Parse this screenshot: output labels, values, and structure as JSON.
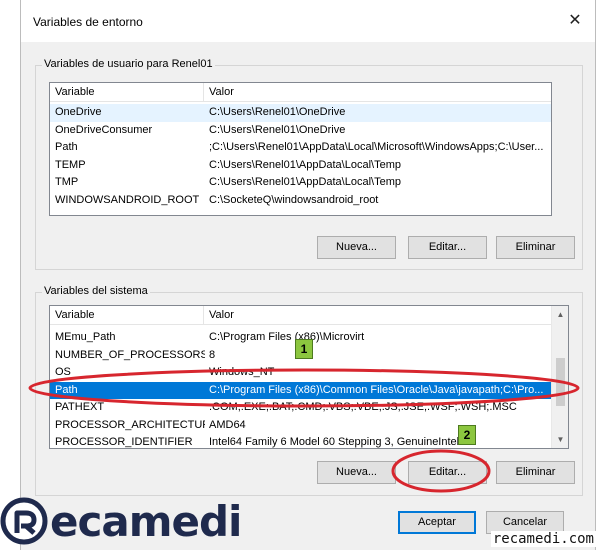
{
  "window": {
    "title": "Variables de entorno",
    "close_glyph": "✕"
  },
  "user_vars": {
    "group_label": "Variables de usuario para Renel01",
    "headers": [
      "Variable",
      "Valor"
    ],
    "rows": [
      {
        "name": "OneDrive",
        "value": "C:\\Users\\Renel01\\OneDrive"
      },
      {
        "name": "OneDriveConsumer",
        "value": "C:\\Users\\Renel01\\OneDrive"
      },
      {
        "name": "Path",
        "value": ";C:\\Users\\Renel01\\AppData\\Local\\Microsoft\\WindowsApps;C:\\User..."
      },
      {
        "name": "TEMP",
        "value": "C:\\Users\\Renel01\\AppData\\Local\\Temp"
      },
      {
        "name": "TMP",
        "value": "C:\\Users\\Renel01\\AppData\\Local\\Temp"
      },
      {
        "name": "WINDOWSANDROID_ROOT",
        "value": "C:\\SocketeQ\\windowsandroid_root"
      }
    ],
    "buttons": {
      "new": "Nueva...",
      "edit": "Editar...",
      "delete": "Eliminar"
    }
  },
  "system_vars": {
    "group_label": "Variables del sistema",
    "headers": [
      "Variable",
      "Valor"
    ],
    "rows": [
      {
        "name": "MEmu_Path",
        "value": "C:\\Program Files (x86)\\Microvirt"
      },
      {
        "name": "NUMBER_OF_PROCESSORS",
        "value": "8"
      },
      {
        "name": "OS",
        "value": "Windows_NT"
      },
      {
        "name": "Path",
        "value": "C:\\Program Files (x86)\\Common Files\\Oracle\\Java\\javapath;C:\\Pro..."
      },
      {
        "name": "PATHEXT",
        "value": ".COM;.EXE;.BAT;.CMD;.VBS;.VBE;.JS;.JSE;.WSF;.WSH;.MSC"
      },
      {
        "name": "PROCESSOR_ARCHITECTURE",
        "value": "AMD64"
      },
      {
        "name": "PROCESSOR_IDENTIFIER",
        "value": "Intel64 Family 6 Model 60 Stepping 3, GenuineIntel"
      }
    ],
    "selected_row": "Path",
    "buttons": {
      "new": "Nueva...",
      "edit": "Editar...",
      "delete": "Eliminar"
    }
  },
  "footer": {
    "accept": "Aceptar",
    "cancel": "Cancelar"
  },
  "annotations": {
    "marker_1": "1",
    "marker_2": "2",
    "highlight_color": "#d7262e",
    "marker_color": "#8cc63f"
  },
  "branding": {
    "logo_text": "ecamedi",
    "watermark": "recamedi.com",
    "logo_color": "#1f2a4d"
  },
  "colors": {
    "selection": "#0078d7",
    "hover": "#e5f3ff",
    "default_button_border": "#0078d7"
  }
}
